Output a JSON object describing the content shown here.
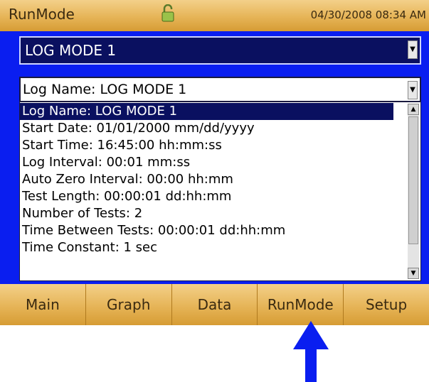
{
  "titlebar": {
    "title": "RunMode",
    "datetime": "04/30/2008 08:34 AM",
    "lock_icon": "lock-open-icon"
  },
  "mode_select": {
    "value": "LOG MODE 1"
  },
  "log_select": {
    "value": "Log Name: LOG MODE 1"
  },
  "list": {
    "items": [
      "Log Name: LOG MODE 1",
      "Start Date: 01/01/2000 mm/dd/yyyy",
      "Start Time: 16:45:00 hh:mm:ss",
      "Log Interval: 00:01 mm:ss",
      "Auto Zero Interval: 00:00 hh:mm",
      "Test Length: 00:00:01 dd:hh:mm",
      "Number of Tests: 2",
      "Time Between Tests: 00:00:01 dd:hh:mm",
      "Time Constant: 1 sec"
    ],
    "selected_index": 0
  },
  "tabs": [
    "Main",
    "Graph",
    "Data",
    "RunMode",
    "Setup"
  ],
  "colors": {
    "screen_bg": "#0a1ef0",
    "bar_gold": "#e6b457",
    "arrow": "#0a1ef0"
  }
}
